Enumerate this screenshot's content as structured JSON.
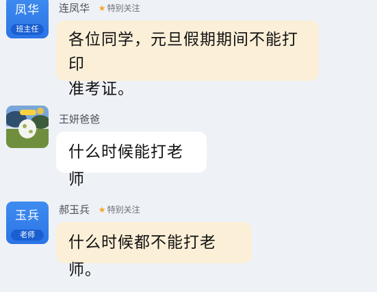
{
  "messages": [
    {
      "avatar_name": "凤华",
      "avatar_role": "班主任",
      "sender": "连凤华",
      "badge": "特别关注",
      "text_line1": "各位同学，元旦假期期间不能打印",
      "text_line2": "准考证。"
    },
    {
      "avatar_icon": "photo-avatar-icon",
      "sender": "王妍爸爸",
      "text": "什么时候能打老师"
    },
    {
      "avatar_name": "玉兵",
      "avatar_role": "老师",
      "sender": "郝玉兵",
      "badge": "特别关注",
      "text": "什么时候都不能打老师。"
    }
  ],
  "colors": {
    "background": "#eef1f6",
    "avatar_blue": "#2a74e6",
    "bubble_warm": "#fcefd8",
    "bubble_white": "#ffffff",
    "star": "#f5a623"
  }
}
